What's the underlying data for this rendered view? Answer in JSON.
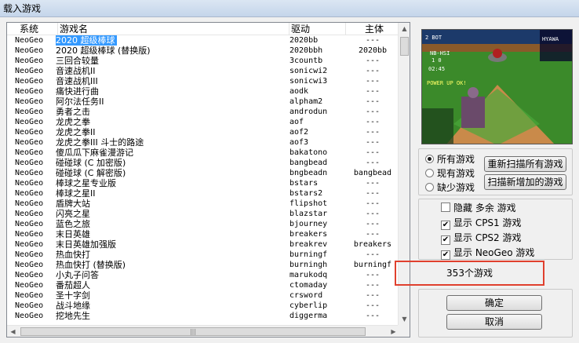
{
  "window": {
    "title": "载入游戏"
  },
  "columns": [
    "系统",
    "游戏名",
    "驱动",
    "主体"
  ],
  "games": [
    {
      "system": "NeoGeo",
      "name": "2020 超级棒球",
      "driver": "2020bb",
      "parent": "---",
      "selected": true
    },
    {
      "system": "NeoGeo",
      "name": "2020 超级棒球 (替换版)",
      "driver": "2020bbh",
      "parent": "2020bb"
    },
    {
      "system": "NeoGeo",
      "name": "三回合较量",
      "driver": "3countb",
      "parent": "---"
    },
    {
      "system": "NeoGeo",
      "name": "音速战机II",
      "driver": "sonicwi2",
      "parent": "---"
    },
    {
      "system": "NeoGeo",
      "name": "音速战机III",
      "driver": "sonicwi3",
      "parent": "---"
    },
    {
      "system": "NeoGeo",
      "name": "痛快进行曲",
      "driver": "aodk",
      "parent": "---"
    },
    {
      "system": "NeoGeo",
      "name": "阿尔法任务II",
      "driver": "alpham2",
      "parent": "---"
    },
    {
      "system": "NeoGeo",
      "name": "勇者之击",
      "driver": "androdun",
      "parent": "---"
    },
    {
      "system": "NeoGeo",
      "name": "龙虎之拳",
      "driver": "aof",
      "parent": "---"
    },
    {
      "system": "NeoGeo",
      "name": "龙虎之拳II",
      "driver": "aof2",
      "parent": "---"
    },
    {
      "system": "NeoGeo",
      "name": "龙虎之拳III 斗士的路途",
      "driver": "aof3",
      "parent": "---"
    },
    {
      "system": "NeoGeo",
      "name": "傻瓜瓜下麻雀漫游记",
      "driver": "bakatono",
      "parent": "---"
    },
    {
      "system": "NeoGeo",
      "name": "碰碰球 (C 加密版)",
      "driver": "bangbead",
      "parent": "---"
    },
    {
      "system": "NeoGeo",
      "name": "碰碰球 (C 解密版)",
      "driver": "bngbeadn",
      "parent": "bangbead"
    },
    {
      "system": "NeoGeo",
      "name": "棒球之星专业版",
      "driver": "bstars",
      "parent": "---"
    },
    {
      "system": "NeoGeo",
      "name": "棒球之星II",
      "driver": "bstars2",
      "parent": "---"
    },
    {
      "system": "NeoGeo",
      "name": "盾牌大站",
      "driver": "flipshot",
      "parent": "---"
    },
    {
      "system": "NeoGeo",
      "name": "闪亮之星",
      "driver": "blazstar",
      "parent": "---"
    },
    {
      "system": "NeoGeo",
      "name": "蓝色之旅",
      "driver": "bjourney",
      "parent": "---"
    },
    {
      "system": "NeoGeo",
      "name": "末日英雄",
      "driver": "breakers",
      "parent": "---"
    },
    {
      "system": "NeoGeo",
      "name": "末日英雄加强版",
      "driver": "breakrev",
      "parent": "breakers"
    },
    {
      "system": "NeoGeo",
      "name": "热血快打",
      "driver": "burningf",
      "parent": "---"
    },
    {
      "system": "NeoGeo",
      "name": "热血快打 (替换版)",
      "driver": "burningh",
      "parent": "burningf"
    },
    {
      "system": "NeoGeo",
      "name": "小丸子问答",
      "driver": "marukodq",
      "parent": "---"
    },
    {
      "system": "NeoGeo",
      "name": "番茄超人",
      "driver": "ctomaday",
      "parent": "---"
    },
    {
      "system": "NeoGeo",
      "name": "圣十字剑",
      "driver": "crsword",
      "parent": "---"
    },
    {
      "system": "NeoGeo",
      "name": "战斗地缘",
      "driver": "cyberlip",
      "parent": "---"
    },
    {
      "system": "NeoGeo",
      "name": "挖地先生",
      "driver": "diggerma",
      "parent": "---"
    }
  ],
  "filter": {
    "options": [
      "所有游戏",
      "现有游戏",
      "缺少游戏"
    ],
    "selected_index": 0
  },
  "buttons": {
    "rescan_all": "重新扫描所有游戏",
    "scan_new": "扫描新增加的游戏",
    "ok": "确定",
    "cancel": "取消"
  },
  "options": [
    {
      "label": "隐藏 多余 游戏",
      "checked": false
    },
    {
      "label": "显示 CPS1 游戏",
      "checked": true
    },
    {
      "label": "显示 CPS2 游戏",
      "checked": true
    },
    {
      "label": "显示 NeoGeo 游戏",
      "checked": true
    }
  ],
  "status": "353个游戏",
  "preview": {
    "hud_left": "2 BOT",
    "score": "NB-HSI",
    "score_line": "1 0",
    "time": "02:45",
    "hud_right": "HYAWA",
    "caption": "POWER UP OK!"
  },
  "colors": {
    "selection": "#3399ff",
    "highlight_border": "#e0402e",
    "preview_field": "#2e6f1d"
  }
}
